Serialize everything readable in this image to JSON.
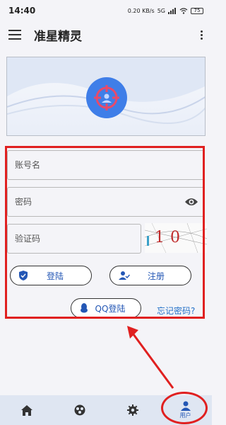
{
  "status_bar": {
    "time": "14:40",
    "speed": "0.20 KB/s",
    "network": "5G",
    "battery": "75"
  },
  "app_bar": {
    "title": "准星精灵"
  },
  "form": {
    "username_placeholder": "账号名",
    "password_placeholder": "密码",
    "captcha_placeholder": "验证码",
    "captcha_code": "10",
    "login_label": "登陆",
    "register_label": "注册",
    "qq_login_label": "QQ登陆",
    "forgot_password": "忘记密码?"
  },
  "bottom_nav": [
    {
      "icon": "home-icon"
    },
    {
      "icon": "community-icon"
    },
    {
      "icon": "settings-gear-icon"
    },
    {
      "icon": "user-icon",
      "label": "用户",
      "active": true
    }
  ],
  "colors": {
    "accent": "#2457b5",
    "link": "#2470c8",
    "annotation": "#e02020",
    "logo_blue": "#3f7ee8"
  }
}
